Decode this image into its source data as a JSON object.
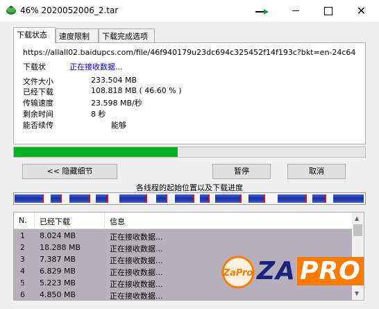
{
  "window": {
    "title": "46% 2020052006_2.tar",
    "close_glyph": "✕"
  },
  "tabs": [
    {
      "label": "下载状态",
      "active": true
    },
    {
      "label": "速度限制",
      "active": false
    },
    {
      "label": "下载完成选项",
      "active": false
    }
  ],
  "status_panel": {
    "url": "https://allall02.baidupcs.com/file/46f940179u23dc694c325452f14f193c?bkt=en-24c64",
    "status_label": "下载状",
    "status_value": "正在接收数据...",
    "file_size_label": "文件大小",
    "file_size_value": "233.504  MB",
    "downloaded_label": "已经下载",
    "downloaded_value": "108.818  MB  ( 46.60 % )",
    "speed_label": "传输速度",
    "speed_value": "23.598  MB/秒",
    "remaining_label": "剩余时间",
    "remaining_value": "8 秒",
    "resume_label": "能否续传",
    "resume_value": "能够"
  },
  "progress": {
    "fraction": 0.466,
    "color": "#06b025"
  },
  "buttons": {
    "hide_details": "<< 隐藏细节",
    "pause": "暂停",
    "cancel": "取消"
  },
  "threads": {
    "title": "各线程的起始位置以及下载进度"
  },
  "thread_list": {
    "columns": [
      "N.",
      "已经下载",
      "信息"
    ],
    "rows": [
      {
        "n": "1",
        "downloaded": "8.024  MB",
        "info": "正在接收数据..."
      },
      {
        "n": "2",
        "downloaded": "18.288  MB",
        "info": "正在接收数据..."
      },
      {
        "n": "3",
        "downloaded": "7.387  MB",
        "info": "正在接收数据..."
      },
      {
        "n": "4",
        "downloaded": "6.829  MB",
        "info": "正在接收数据..."
      },
      {
        "n": "5",
        "downloaded": "5.223  MB",
        "info": "正在接收数据..."
      },
      {
        "n": "6",
        "downloaded": "4.850  MB",
        "info": "正在接收数据..."
      }
    ]
  },
  "watermark": {
    "badge_text": "ZaPro",
    "brand_za": "ZA",
    "brand_pro": "PRO",
    "orange": "#ff7b00",
    "navy": "#1a237e"
  }
}
